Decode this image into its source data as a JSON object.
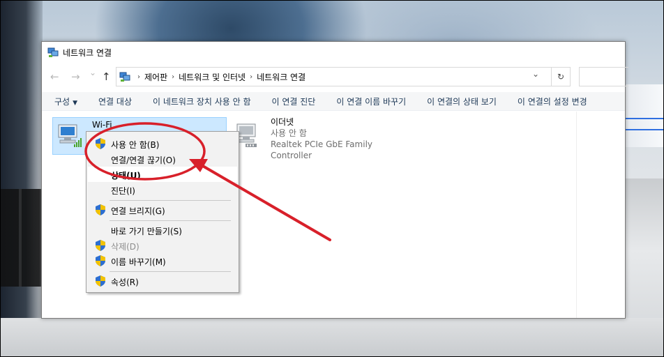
{
  "window": {
    "title": "네트워크 연결"
  },
  "nav": {
    "back": "←",
    "forward": "→",
    "recent": "⌄",
    "up": "↑",
    "breadcrumbs": [
      "제어판",
      "네트워크 및 인터넷",
      "네트워크 연결"
    ],
    "breadcrumb_sep": "›",
    "dropdown": "⌄",
    "refresh": "↻"
  },
  "toolbar": {
    "organize": "구성",
    "organize_arrow": "▼",
    "commands": [
      "연결 대상",
      "이 네트워크 장치 사용 안 함",
      "이 연결 진단",
      "이 연결 이름 바꾸기",
      "이 연결의 상태 보기",
      "이 연결의 설정 변경"
    ]
  },
  "connections": [
    {
      "name": "Wi-Fi",
      "status": "",
      "adapter": ""
    },
    {
      "name": "이더넷",
      "status": "사용 안 함",
      "adapter": "Realtek PCIe GbE Family Controller"
    }
  ],
  "context_menu": {
    "items": [
      {
        "label": "사용 안 함(B)",
        "shield": true
      },
      {
        "label": "연결/연결 끊기(O)",
        "shield": false
      },
      {
        "label": "상태(U)",
        "shield": false,
        "bold": true
      },
      {
        "label": "진단(I)",
        "shield": false
      },
      {
        "label": "연결 브리지(G)",
        "shield": true
      },
      {
        "label": "바로 가기 만들기(S)",
        "shield": false
      },
      {
        "label": "삭제(D)",
        "shield": true,
        "disabled": true
      },
      {
        "label": "이름 바꾸기(M)",
        "shield": true
      },
      {
        "label": "속성(R)",
        "shield": true
      }
    ]
  },
  "icons": {
    "network_connections": "network-connections-icon",
    "ethernet": "ethernet-adapter-icon",
    "wifi": "wifi-adapter-icon",
    "shield": "uac-shield-icon"
  },
  "colors": {
    "annotation": "#d8202a",
    "selection": "#cce8ff",
    "command_text": "#1e3957"
  }
}
